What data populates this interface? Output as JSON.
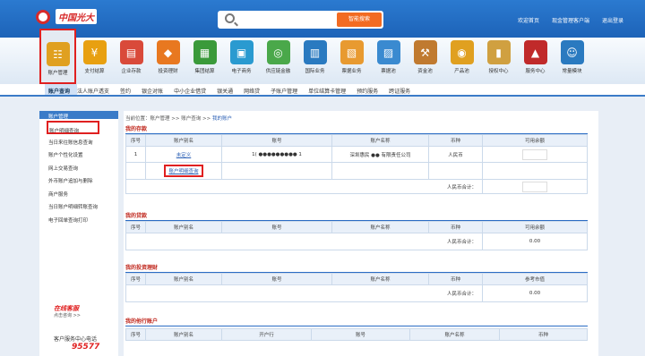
{
  "header": {
    "logo_text": "中国光大",
    "search_button": "智能搜索",
    "links": [
      "欢迎首页",
      "现金管理客户端",
      "退出登录"
    ]
  },
  "icons": [
    {
      "label": "账户管理",
      "color": "#e0a020",
      "glyph": "☷"
    },
    {
      "label": "支付结算",
      "color": "#e8a010",
      "glyph": "¥"
    },
    {
      "label": "企业存款",
      "color": "#d94a3a",
      "glyph": "▤"
    },
    {
      "label": "投资理财",
      "color": "#e87820",
      "glyph": "◆"
    },
    {
      "label": "集团结算",
      "color": "#3a9a3a",
      "glyph": "▦"
    },
    {
      "label": "电子商务",
      "color": "#2a9ad0",
      "glyph": "▣"
    },
    {
      "label": "供应链金融",
      "color": "#4aa84a",
      "glyph": "◎"
    },
    {
      "label": "国际业务",
      "color": "#2a7ac0",
      "glyph": "▥"
    },
    {
      "label": "票据业务",
      "color": "#e89a30",
      "glyph": "▧"
    },
    {
      "label": "票据池",
      "color": "#3a8ad0",
      "glyph": "▨"
    },
    {
      "label": "资金池",
      "color": "#c07a30",
      "glyph": "⚒"
    },
    {
      "label": "产品池",
      "color": "#e0a020",
      "glyph": "◉"
    },
    {
      "label": "授权中心",
      "color": "#d0a040",
      "glyph": "▮"
    },
    {
      "label": "服务中心",
      "color": "#c02a2a",
      "glyph": "▲"
    },
    {
      "label": "常量模块",
      "color": "#2a7ac0",
      "glyph": "☺"
    }
  ],
  "subnav": [
    "账户查询",
    "法人账户透支",
    "签约",
    "银企对账",
    "中小企业借贷",
    "银关通",
    "网络贷",
    "子账户管理",
    "单位结算卡管理",
    "预约服务",
    "跨证服务"
  ],
  "sidebar": {
    "header": "账户管理",
    "items": [
      "账户明细查询",
      "当日来往账信息查询",
      "账户个性化设置",
      "网上交易查询",
      "外币账户追加与删除",
      "商户服务",
      "当日账户明细转账查询",
      "电子回单查询打印"
    ]
  },
  "promo": {
    "title": "在线客服",
    "sub": "点击咨询 >>",
    "hotline_label": "客户服务中心电话",
    "hotline": "95577"
  },
  "breadcrumb": {
    "prefix": "当前位置：",
    "path": "账户管理 >> 账户查询 >> ",
    "current": "我的账户"
  },
  "deposit": {
    "title": "我的存款",
    "headers": [
      "序号",
      "账户别名",
      "账号",
      "账户名称",
      "币种",
      "可用余额"
    ],
    "row": {
      "no": "1",
      "alias": "未定义",
      "account": "1( ●●●●●●●●● 1",
      "name": "深圳惠民 ●● 有限责任公司",
      "currency": "人民币"
    },
    "detail_link": "账户明细查询",
    "total_label": "人民币合计："
  },
  "loan": {
    "title": "我的贷款",
    "headers": [
      "序号",
      "账户别名",
      "账号",
      "账户名称",
      "币种",
      "可用余额"
    ],
    "total_label": "人民币合计：",
    "total": "0.00"
  },
  "invest": {
    "title": "我的投资理财",
    "headers": [
      "序号",
      "账户别名",
      "账号",
      "账户名称",
      "币种",
      "参考市值"
    ],
    "total_label": "人民币合计：",
    "total": "0.00"
  },
  "agent": {
    "title": "我的他行账户",
    "headers": [
      "序号",
      "账户别名",
      "开户行",
      "账号",
      "账户名称",
      "币种"
    ]
  }
}
